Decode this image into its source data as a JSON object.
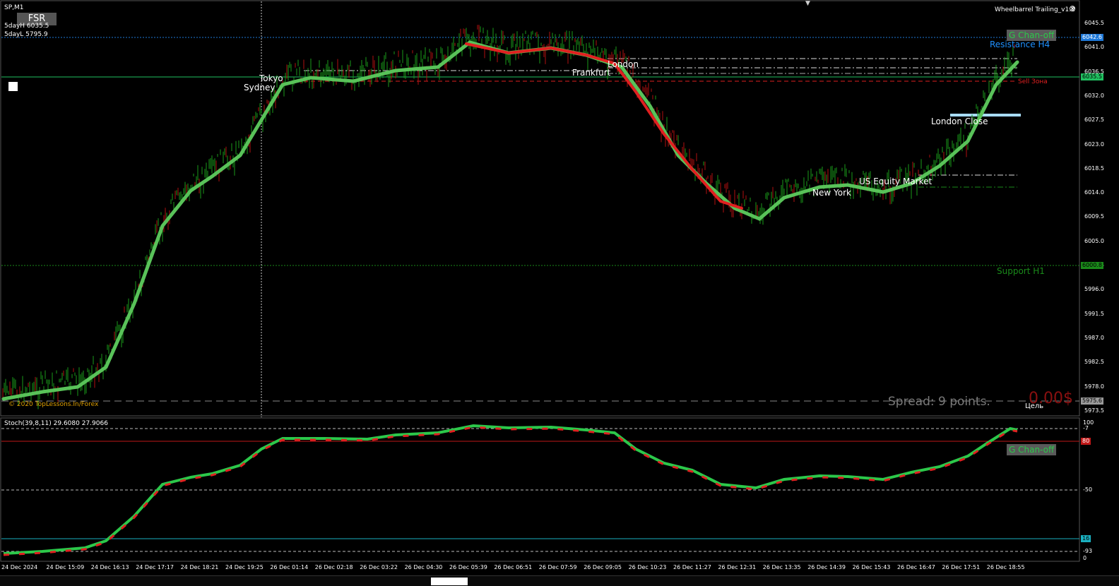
{
  "window": {
    "symbol_title": "SP,M1",
    "indicator_name": "Wheelbarrel Trailing_v1.2"
  },
  "fsr_button": "FSR",
  "info": {
    "day_high": "5dayH 6035.5",
    "day_low": "5dayL 5795.9",
    "copyright": "© 2020 TopLessons.In/Forex"
  },
  "sessions": {
    "tokyo": "Tokyo",
    "sydney": "Sydney",
    "frankfurt": "Frankfurt",
    "london": "London",
    "new_york": "New York",
    "us_equity": "US Equity Market",
    "london_close": "London Close"
  },
  "levels": {
    "resistance": "Resistance H4",
    "support": "Support H1",
    "sell_zone": "Sell Зона",
    "target": "Цель",
    "g_chan_main": "G Chan-off",
    "g_chan_stoch": "G Chan-off"
  },
  "status": {
    "spread": "Spread: 9 points.",
    "profit": "0.00$"
  },
  "price_axis": {
    "ticks": [
      "6045.5",
      "6041.0",
      "6036.5",
      "6032.0",
      "6027.5",
      "6023.0",
      "6018.5",
      "6014.0",
      "6009.5",
      "6005.0",
      "6000.5",
      "5996.0",
      "5991.5",
      "5987.0",
      "5982.5",
      "5978.0",
      "5973.5"
    ],
    "tag_top": "6042.6",
    "tag_current": "6035.5",
    "tag_support": "6000.8",
    "tag_bottom": "5975.6"
  },
  "stoch": {
    "header": "Stoch(39,8,11) 29.6080 27.9066",
    "axis": [
      "100",
      "-7",
      "-50",
      "-93",
      "0"
    ],
    "tag_level_high": "80",
    "tag_level_low": "16"
  },
  "time_axis": [
    "24 Dec 2024",
    "24 Dec 15:09",
    "24 Dec 16:13",
    "24 Dec 17:17",
    "24 Dec 18:21",
    "24 Dec 19:25",
    "26 Dec 01:14",
    "26 Dec 02:18",
    "26 Dec 03:22",
    "26 Dec 04:30",
    "26 Dec 05:39",
    "26 Dec 06:51",
    "26 Dec 07:59",
    "26 Dec 09:05",
    "26 Dec 10:23",
    "26 Dec 11:27",
    "26 Dec 12:31",
    "26 Dec 13:35",
    "26 Dec 14:39",
    "26 Dec 15:43",
    "26 Dec 16:47",
    "26 Dec 17:51",
    "26 Dec 18:55"
  ],
  "colors": {
    "bull": "#2cc84a",
    "bear": "#e02020",
    "trail": "#59c259",
    "resistance": "#1e90ff",
    "support": "#1a8a1a",
    "stoch_line": "#1ab0c0"
  }
}
